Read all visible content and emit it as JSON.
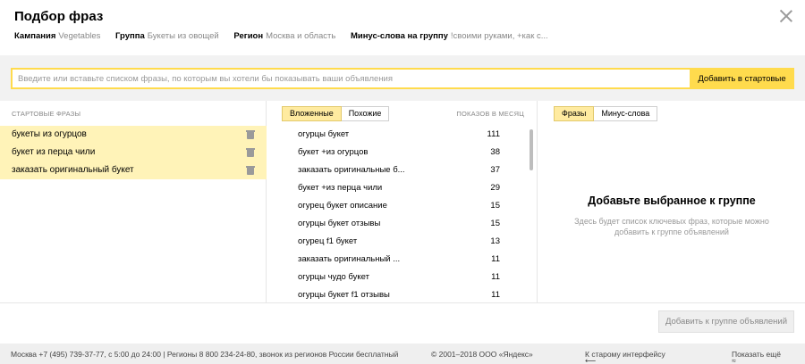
{
  "header": {
    "title": "Подбор фраз",
    "meta": [
      {
        "key": "Кампания",
        "value": "Vegetables"
      },
      {
        "key": "Группа",
        "value": "Букеты из овощей"
      },
      {
        "key": "Регион",
        "value": "Москва и область"
      },
      {
        "key": "Минус-слова на группу",
        "value": "!своими руками, +как с..."
      }
    ]
  },
  "input": {
    "placeholder": "Введите или вставьте списком фразы, по которым вы хотели бы показывать ваши объявления",
    "add_button": "Добавить в стартовые"
  },
  "start_phrases": {
    "heading": "СТАРТОВЫЕ ФРАЗЫ",
    "items": [
      "букеты из огурцов",
      "букет из перца чили",
      "заказать оригинальный букет"
    ]
  },
  "suggestions": {
    "tabs": [
      "Вложенные",
      "Похожие"
    ],
    "active_tab": 0,
    "count_heading": "ПОКАЗОВ В МЕСЯЦ",
    "rows": [
      {
        "phrase": "огурцы букет",
        "count": "111"
      },
      {
        "phrase": "букет +из огурцов",
        "count": "38"
      },
      {
        "phrase": "заказать оригинальные б...",
        "count": "37"
      },
      {
        "phrase": "букет +из перца чили",
        "count": "29"
      },
      {
        "phrase": "огурец букет описание",
        "count": "15"
      },
      {
        "phrase": "огурцы букет отзывы",
        "count": "15"
      },
      {
        "phrase": "огурец f1 букет",
        "count": "13"
      },
      {
        "phrase": "заказать оригинальный ...",
        "count": "11"
      },
      {
        "phrase": "огурцы чудо букет",
        "count": "11"
      },
      {
        "phrase": "огурцы букет f1 отзывы",
        "count": "11"
      }
    ]
  },
  "group": {
    "tabs": [
      "Фразы",
      "Минус-слова"
    ],
    "active_tab": 0,
    "empty_title": "Добавьте выбранное к группе",
    "empty_text": "Здесь будет список ключевых фраз, которые можно добавить к группе объявлений"
  },
  "actions": {
    "add_to_group": "Добавить к группе объявлений"
  },
  "footer": {
    "contacts": "Москва +7 (495) 739-37-77, с 5:00 до 24:00  |  Регионы 8 800 234-24-80, звонок из регионов России бесплатный",
    "copyright": "© 2001–2018 ООО «Яндекс»",
    "old_interface": "К старому интерфейсу",
    "show_more": "Показать ещё"
  },
  "colors": {
    "accent": "#ffdb4d",
    "selected_row": "#fff3b8",
    "active_tab": "#ffeba0"
  }
}
